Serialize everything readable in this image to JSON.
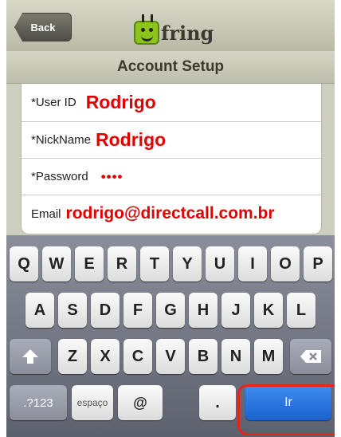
{
  "nav": {
    "back_label": "Back",
    "logo_text": "fring"
  },
  "title": "Account Setup",
  "form": {
    "fields": [
      {
        "label": "*User ID",
        "value": "Rodrigo"
      },
      {
        "label": "*NickName",
        "value": "Rodrigo"
      },
      {
        "label": "*Password",
        "value": "••••"
      },
      {
        "label": "Email",
        "value": "rodrigo@directcall.com.br"
      }
    ]
  },
  "keyboard": {
    "row1": [
      "Q",
      "W",
      "E",
      "R",
      "T",
      "Y",
      "U",
      "I",
      "O",
      "P"
    ],
    "row2": [
      "A",
      "S",
      "D",
      "F",
      "G",
      "H",
      "J",
      "K",
      "L"
    ],
    "row3": [
      "Z",
      "X",
      "C",
      "V",
      "B",
      "N",
      "M"
    ],
    "numbers_label": ".?123",
    "space_label": "espaço",
    "at_label": "@",
    "dot_label": ".",
    "go_label": "Ir"
  },
  "colors": {
    "value_text": "#e00000",
    "go_key": "#1a62cf",
    "annotation": "#e5241b"
  }
}
